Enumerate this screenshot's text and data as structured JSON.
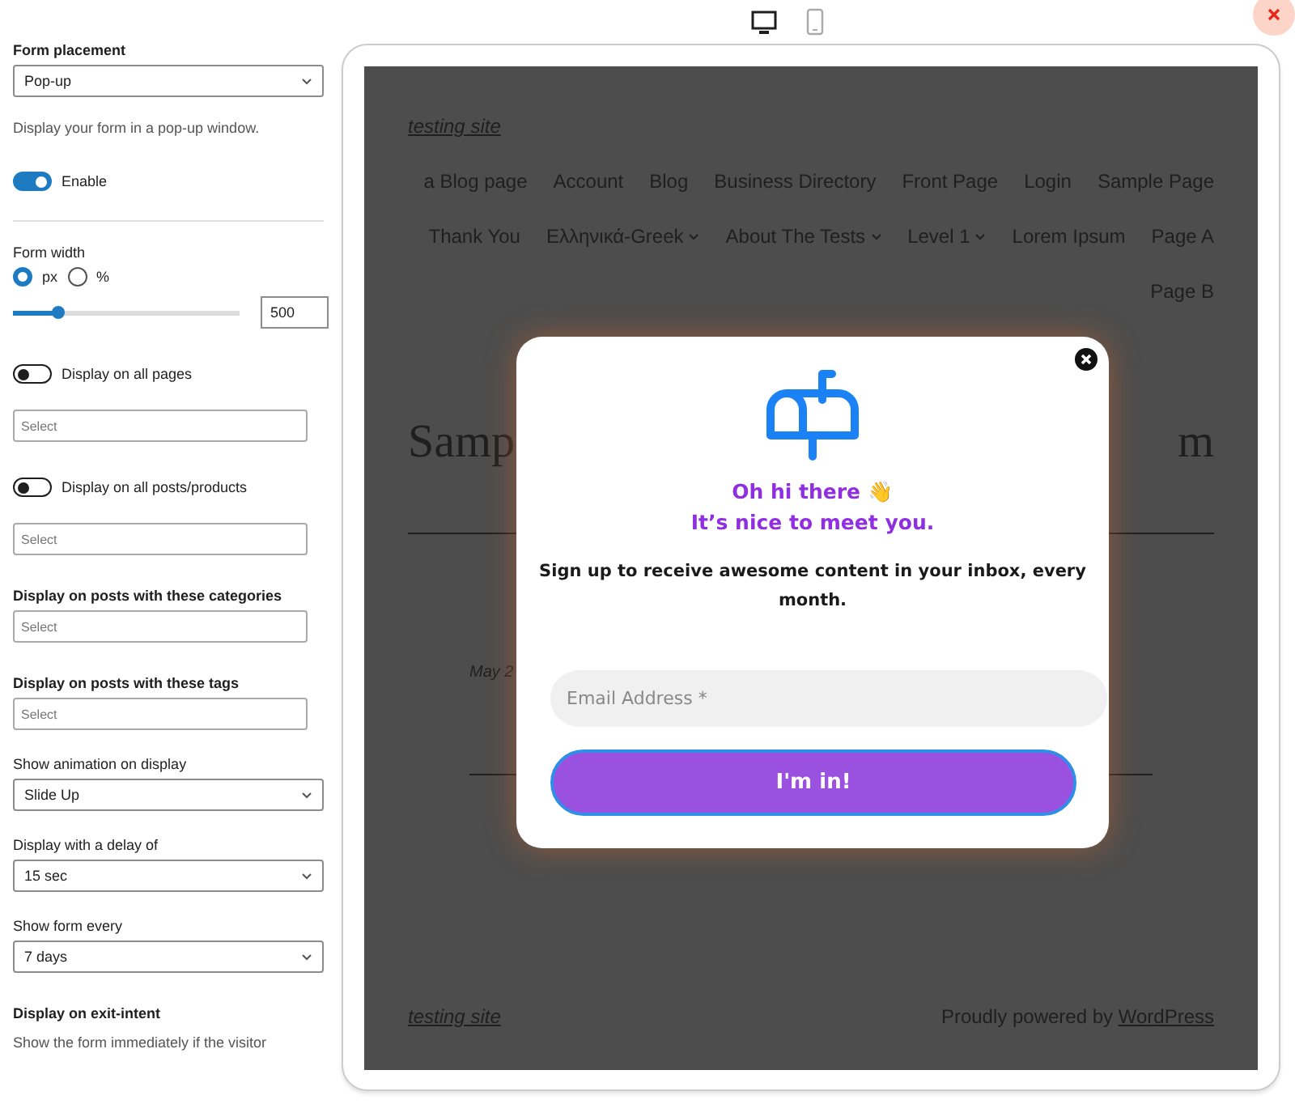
{
  "settings": [
    {
      "kind": "heading",
      "text": "Form placement"
    },
    {
      "kind": "select",
      "value": "Pop-up"
    },
    {
      "kind": "help",
      "text": "Display your form in a pop-up window."
    },
    {
      "kind": "toggle",
      "label": "Enable",
      "on": true
    },
    {
      "kind": "divider"
    },
    {
      "kind": "label",
      "text": "Form width"
    },
    {
      "kind": "radios",
      "options": [
        {
          "label": "px",
          "selected": true
        },
        {
          "label": "%",
          "selected": false
        }
      ]
    },
    {
      "kind": "slider",
      "level": 0.2,
      "value": "500"
    },
    {
      "kind": "toggle",
      "label": "Display on all pages",
      "on": false
    },
    {
      "kind": "multiselect",
      "placeholder": "Select"
    },
    {
      "kind": "toggle",
      "label": "Display on all posts/products",
      "on": false
    },
    {
      "kind": "multiselect",
      "placeholder": "Select"
    },
    {
      "kind": "heading",
      "text": "Display on posts with these categories"
    },
    {
      "kind": "multiselect",
      "placeholder": "Select"
    },
    {
      "kind": "heading",
      "text": "Display on posts with these tags"
    },
    {
      "kind": "multiselect",
      "placeholder": "Select"
    },
    {
      "kind": "label",
      "text": "Show animation on display"
    },
    {
      "kind": "select",
      "value": "Slide Up"
    },
    {
      "kind": "label",
      "text": "Display with a delay of"
    },
    {
      "kind": "select",
      "value": "15 sec"
    },
    {
      "kind": "label",
      "text": "Show form every"
    },
    {
      "kind": "select",
      "value": "7 days"
    },
    {
      "kind": "heading",
      "text": "Display on exit-intent"
    },
    {
      "kind": "help",
      "text": "Show the form immediately if the visitor"
    }
  ],
  "device_toggle": [
    {
      "kind": "desktop",
      "selected": true
    },
    {
      "kind": "mobile",
      "selected": false
    }
  ],
  "site": {
    "title": "testing site",
    "nav_rows": [
      [
        {
          "label": "a Blog page",
          "submenu": false
        },
        {
          "label": "Account",
          "submenu": false
        },
        {
          "label": "Blog",
          "submenu": false
        },
        {
          "label": "Business Directory",
          "submenu": false
        },
        {
          "label": "Front Page",
          "submenu": false
        },
        {
          "label": "Login",
          "submenu": false
        },
        {
          "label": "Sample Page",
          "submenu": false
        }
      ],
      [
        {
          "label": "Thank You",
          "submenu": false
        },
        {
          "label": "Ελληνικά-Greek",
          "submenu": true
        },
        {
          "label": "About The Tests",
          "submenu": true
        },
        {
          "label": "Level 1",
          "submenu": true
        },
        {
          "label": "Lorem Ipsum",
          "submenu": false
        },
        {
          "label": "Page A",
          "submenu": false
        }
      ],
      [
        {
          "label": "Page B",
          "submenu": false
        }
      ]
    ],
    "heading_start": "Samp",
    "heading_end": "m",
    "date": "May 2",
    "footer_title": "testing site",
    "footer_text": "Proudly powered by ",
    "footer_link": "WordPress"
  },
  "popup": {
    "greeting": "Oh hi there 👋",
    "greeting_2": "It’s nice to meet you.",
    "message": "Sign up to receive awesome content in your inbox, every month.",
    "email_placeholder": "Email Address *",
    "button": "I'm in!"
  }
}
